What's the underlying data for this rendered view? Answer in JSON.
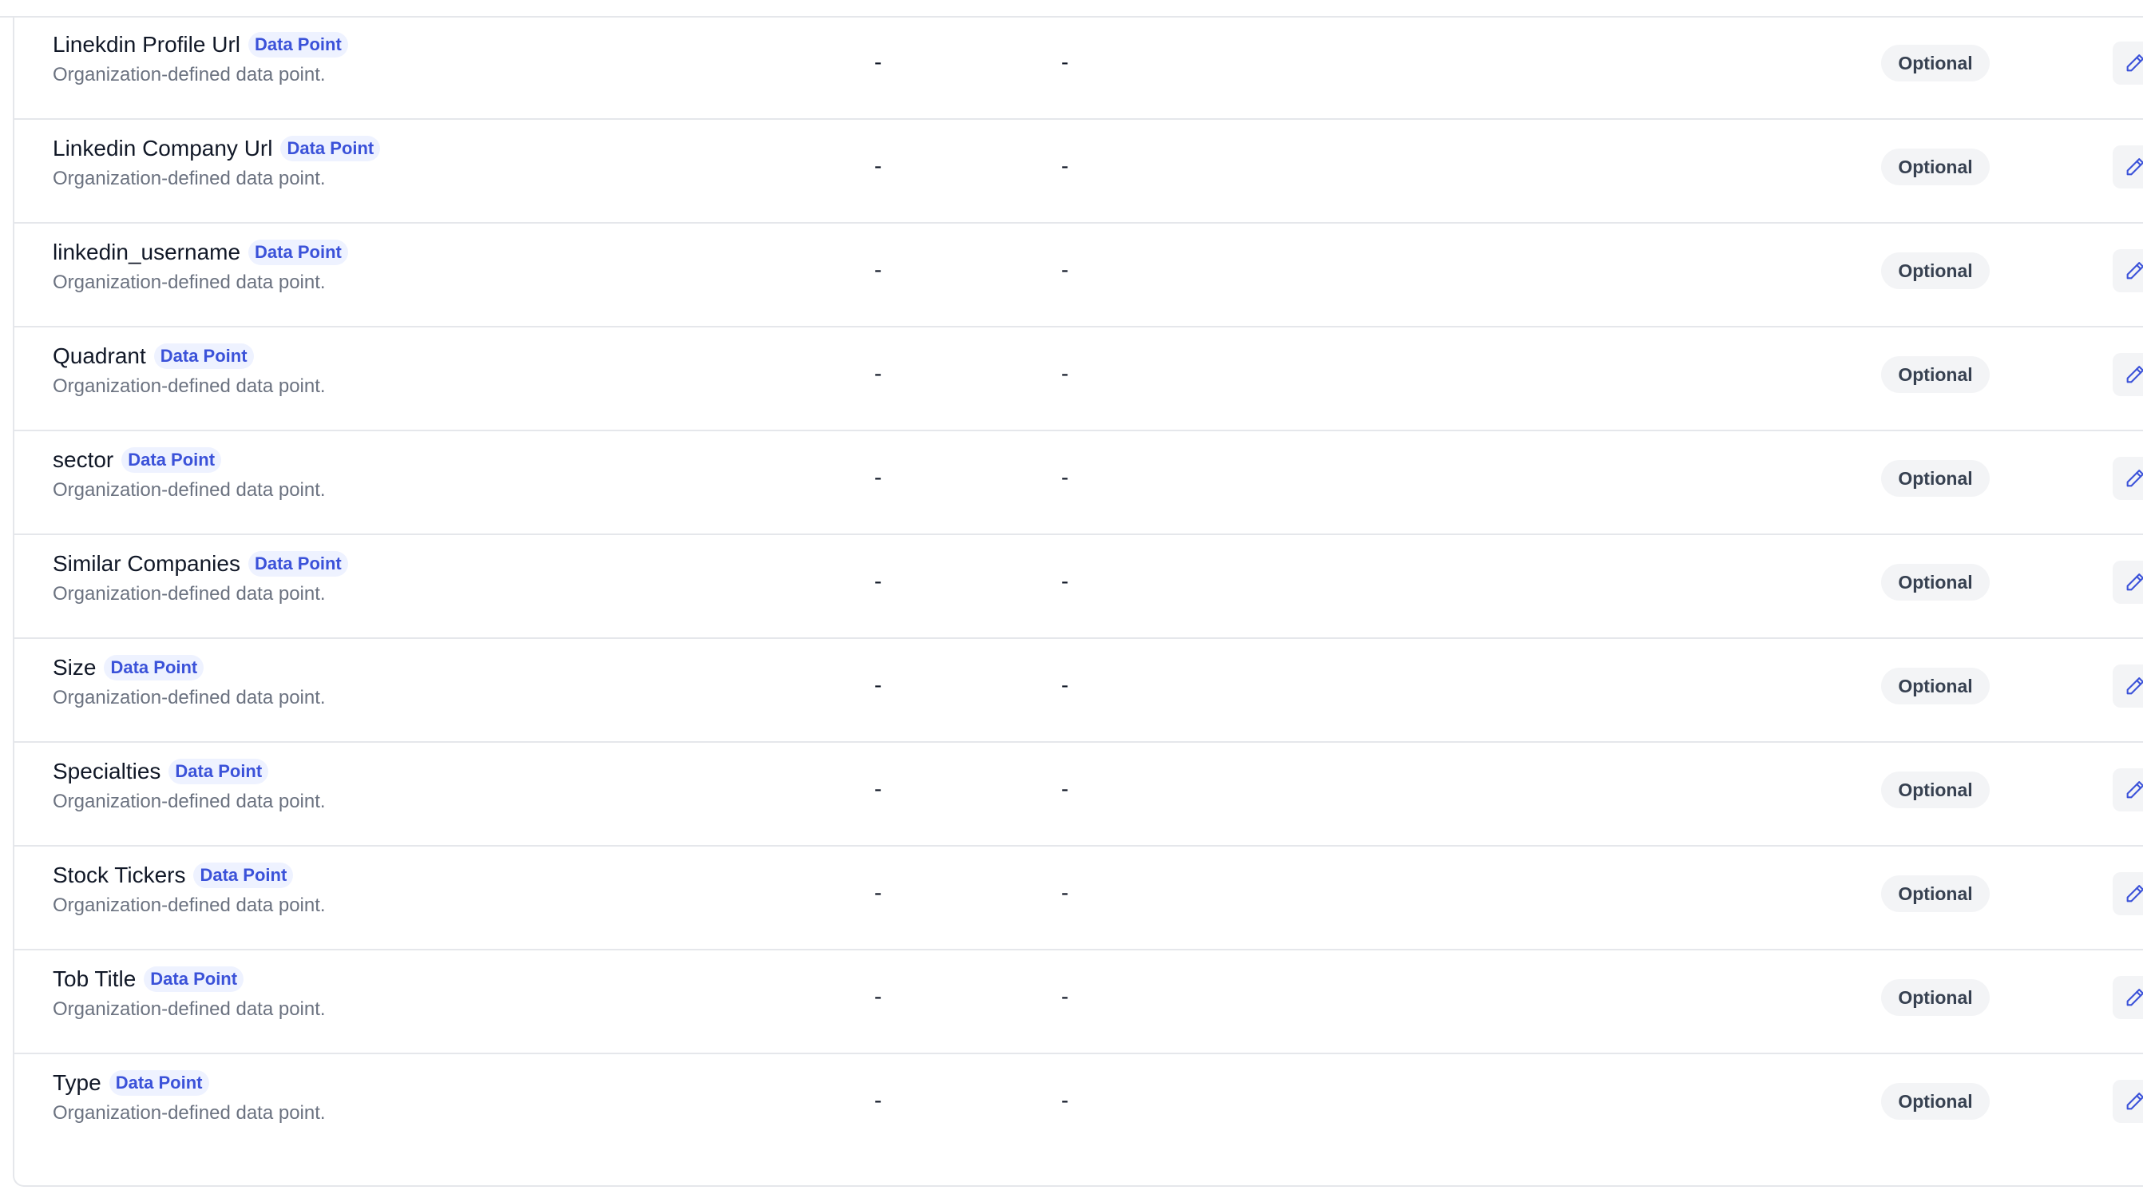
{
  "table": {
    "rows": [
      {
        "name": "Linekdin Profile Url",
        "tag": "Data Point",
        "description": "Organization-defined data point.",
        "col1": "-",
        "col2": "-",
        "status": "Optional",
        "icon": "pencil-icon"
      },
      {
        "name": "Linkedin Company Url",
        "tag": "Data Point",
        "description": "Organization-defined data point.",
        "col1": "-",
        "col2": "-",
        "status": "Optional",
        "icon": "pencil-icon"
      },
      {
        "name": "linkedin_username",
        "tag": "Data Point",
        "description": "Organization-defined data point.",
        "col1": "-",
        "col2": "-",
        "status": "Optional",
        "icon": "pencil-icon"
      },
      {
        "name": "Quadrant",
        "tag": "Data Point",
        "description": "Organization-defined data point.",
        "col1": "-",
        "col2": "-",
        "status": "Optional",
        "icon": "pencil-icon"
      },
      {
        "name": "sector",
        "tag": "Data Point",
        "description": "Organization-defined data point.",
        "col1": "-",
        "col2": "-",
        "status": "Optional",
        "icon": "pencil-icon"
      },
      {
        "name": "Similar Companies",
        "tag": "Data Point",
        "description": "Organization-defined data point.",
        "col1": "-",
        "col2": "-",
        "status": "Optional",
        "icon": "pencil-icon"
      },
      {
        "name": "Size",
        "tag": "Data Point",
        "description": "Organization-defined data point.",
        "col1": "-",
        "col2": "-",
        "status": "Optional",
        "icon": "pencil-icon"
      },
      {
        "name": "Specialties",
        "tag": "Data Point",
        "description": "Organization-defined data point.",
        "col1": "-",
        "col2": "-",
        "status": "Optional",
        "icon": "pencil-icon"
      },
      {
        "name": "Stock Tickers",
        "tag": "Data Point",
        "description": "Organization-defined data point.",
        "col1": "-",
        "col2": "-",
        "status": "Optional",
        "icon": "pencil-icon"
      },
      {
        "name": "Tob Title",
        "tag": "Data Point",
        "description": "Organization-defined data point.",
        "col1": "-",
        "col2": "-",
        "status": "Optional",
        "icon": "pencil-icon"
      },
      {
        "name": "Type",
        "tag": "Data Point",
        "description": "Organization-defined data point.",
        "col1": "-",
        "col2": "-",
        "status": "Optional",
        "icon": "pencil-icon"
      }
    ]
  },
  "colors": {
    "tag_text": "#3b52d9",
    "tag_bg": "#eef2ff",
    "badge_bg": "#f3f4f6",
    "border": "#e5e7eb"
  }
}
